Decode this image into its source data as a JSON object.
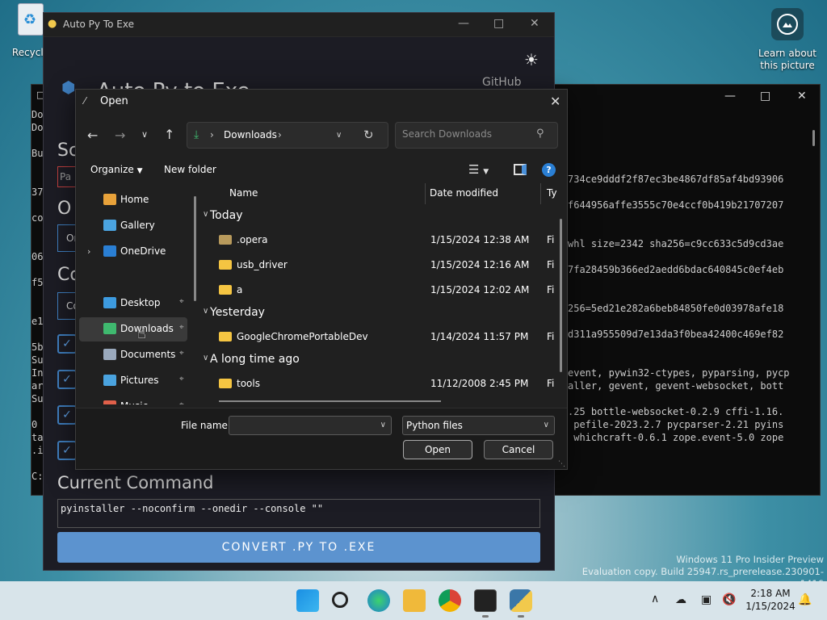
{
  "desktop": {
    "recycle_label": "Recycle",
    "learn_label": "Learn about this picture",
    "watermark_line1": "Windows 11 Pro Insider Preview",
    "watermark_line2": "Evaluation copy. Build 25947.rs_prerelease.230901-1416"
  },
  "console": {
    "lines_left": [
      "Do",
      "Do",
      "Bu",
      "37",
      "co",
      "06",
      "f5",
      "e1",
      "5b",
      "Su",
      "In",
      "ar",
      "Su",
      "0",
      "ta",
      ".i",
      "C:"
    ],
    "lines_right": [
      "734ce9dddf2f87ec3be4867df85af4bd93906",
      "f644956affe3555c70e4ccf0b419b21707207",
      "whl size=2342 sha256=c9cc633c5d9cd3ae",
      "7fa28459b366ed2aedd6bdac640845c0ef4eb",
      "256=5ed21e282a6beb84850fe0d03978afe18",
      "d311a955509d7e13da3f0bea42400c469ef82",
      "event, pywin32-ctypes, pyparsing, pycp",
      "aller, gevent, gevent-websocket, bott",
      ".25 bottle-websocket-0.2.9 cffi-1.16.",
      " pefile-2023.2.7 pycparser-2.21 pyins",
      " whichcraft-0.6.1 zope.event-5.0 zope"
    ]
  },
  "autopy": {
    "window_title": "Auto Py To Exe",
    "heading": "Auto Py to Exe",
    "github": "GitHub",
    "side_labels": [
      "Sc",
      "Pa",
      "O",
      "Or",
      "Co",
      "Co"
    ],
    "current_command_label": "Current Command",
    "current_command": "pyinstaller --noconfirm --onedir --console  \"\"",
    "convert_label": "CONVERT .PY TO .EXE"
  },
  "dialog": {
    "title": "Open",
    "breadcrumb": "Downloads",
    "search_placeholder": "Search Downloads",
    "organize": "Organize",
    "new_folder": "New folder",
    "columns": {
      "name": "Name",
      "date": "Date modified",
      "type": "Ty"
    },
    "nav_items": [
      {
        "label": "Home",
        "icon": "home-icon",
        "pinned": false
      },
      {
        "label": "Gallery",
        "icon": "gallery-icon",
        "pinned": false
      },
      {
        "label": "OneDrive",
        "icon": "onedrive-icon",
        "pinned": false
      },
      {
        "label": "Desktop",
        "icon": "desktop-icon",
        "pinned": true
      },
      {
        "label": "Downloads",
        "icon": "downloads-icon",
        "pinned": true
      },
      {
        "label": "Documents",
        "icon": "documents-icon",
        "pinned": true
      },
      {
        "label": "Pictures",
        "icon": "pictures-icon",
        "pinned": true
      },
      {
        "label": "Music",
        "icon": "music-icon",
        "pinned": true
      }
    ],
    "groups": [
      {
        "label": "Today",
        "files": [
          {
            "name": ".opera",
            "date": "1/15/2024 12:38 AM",
            "type": "Fi"
          },
          {
            "name": "usb_driver",
            "date": "1/15/2024 12:16 AM",
            "type": "Fi"
          },
          {
            "name": "a",
            "date": "1/15/2024 12:02 AM",
            "type": "Fi"
          }
        ]
      },
      {
        "label": "Yesterday",
        "files": [
          {
            "name": "GoogleChromePortableDev",
            "date": "1/14/2024 11:57 PM",
            "type": "Fi"
          }
        ]
      },
      {
        "label": "A long time ago",
        "files": [
          {
            "name": "tools",
            "date": "11/12/2008 2:45 PM",
            "type": "Fi"
          }
        ]
      }
    ],
    "file_name_label": "File name:",
    "file_name_value": "",
    "file_type": "Python files",
    "open_button": "Open",
    "cancel_button": "Cancel"
  },
  "taskbar": {
    "time": "2:18 AM",
    "date": "1/15/2024",
    "apps": [
      "start-icon",
      "search-icon",
      "edge-icon",
      "file-explorer-icon",
      "chrome-icon",
      "terminal-icon",
      "python-icon"
    ]
  },
  "colors": {
    "accent": "#5c93cf",
    "folder": "#f5c542",
    "dialog_bg": "#202020",
    "selected": "#3a3a3a"
  }
}
